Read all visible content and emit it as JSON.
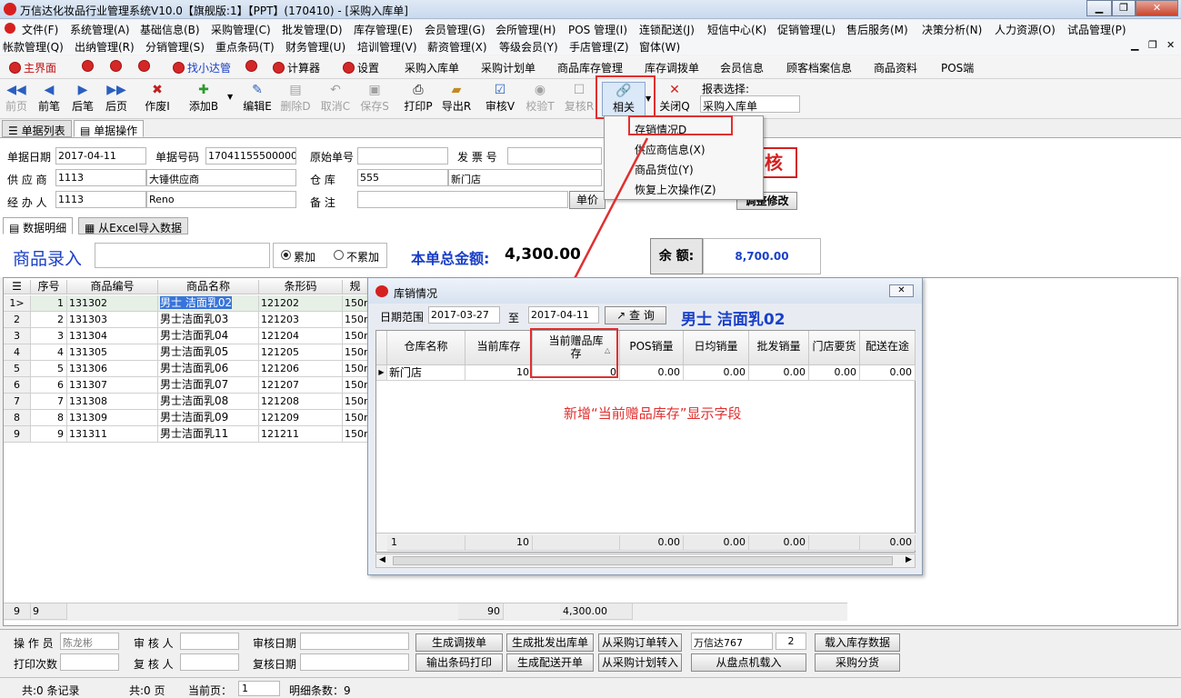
{
  "window": {
    "title": "万信达化妆品行业管理系统V10.0【旗舰版:1】【PPT】(170410) - [采购入库单]",
    "minimize": "▁",
    "restore": "❐",
    "close": "✕",
    "child_minimize": "▁",
    "child_restore": "❐",
    "child_close": "✕"
  },
  "menu_row1": [
    "文件(F)",
    "系统管理(A)",
    "基础信息(B)",
    "采购管理(C)",
    "批发管理(D)",
    "库存管理(E)",
    "会员管理(G)",
    "会所管理(H)",
    "POS 管理(I)",
    "连锁配送(J)",
    "短信中心(K)",
    "促销管理(L)",
    "售后服务(M)",
    "决策分析(N)",
    "人力资源(O)",
    "试品管理(P)"
  ],
  "menu_row2": [
    "帐款管理(Q)",
    "出纳管理(R)",
    "分销管理(S)",
    "重点条码(T)",
    "财务管理(U)",
    "培训管理(V)",
    "薪资管理(X)",
    "等级会员(Y)",
    "手店管理(Z)",
    "窗体(W)"
  ],
  "quickbar": [
    "主界面",
    "",
    "",
    "",
    "找小达管",
    "",
    "计算器",
    "设置",
    "采购入库单",
    "采购计划单",
    "商品库存管理",
    "库存调拨单",
    "会员信息",
    "顾客档案信息",
    "商品资料",
    "POS端"
  ],
  "toolbar": {
    "buttons": [
      "前页",
      "前笔",
      "后笔",
      "后页",
      "作废I",
      "添加B",
      "编辑E",
      "删除D",
      "取消C",
      "保存S",
      "打印P",
      "导出R",
      "审核V",
      "校验T",
      "复核R",
      "相关",
      "关闭Q"
    ],
    "report_label": "报表选择:",
    "report_value": "采购入库单"
  },
  "tabs1": [
    "单据列表",
    "单据操作"
  ],
  "form": {
    "date_label": "单据日期",
    "date_value": "2017-04-11",
    "number_label": "单据号码",
    "number_value": "1704115550000001",
    "orig_label": "原始单号",
    "orig_value": "",
    "invoice_label": "发 票 号",
    "invoice_value": "",
    "supplier_label": "供 应 商",
    "supplier_code": "1113",
    "supplier_name": "大锤供应商",
    "warehouse_label": "仓    库",
    "warehouse_code": "555",
    "warehouse_name": "新门店",
    "handler_label": "经 办 人",
    "handler_code": "1113",
    "handler_name": "Reno",
    "note_label": "备    注",
    "note_value": "",
    "stamp": "审核",
    "price_btn": "单价",
    "modify_btn": "调整修改"
  },
  "tabs2": [
    "数据明细",
    "从Excel导入数据"
  ],
  "entry": {
    "label": "商品录入",
    "radio1": "累加",
    "radio2": "不累加",
    "total_label": "本单总金额:",
    "total_value": "4,300.00",
    "balance_label": "余 额:",
    "balance_value": "8,700.00"
  },
  "grid": {
    "headers": [
      "序号",
      "商品编号",
      "商品名称",
      "条形码",
      "规"
    ],
    "rows": [
      [
        "1",
        "131302",
        "男士 洁面乳02",
        "121202",
        "150m"
      ],
      [
        "2",
        "131303",
        "男士洁面乳03",
        "121203",
        "150m"
      ],
      [
        "3",
        "131304",
        "男士洁面乳04",
        "121204",
        "150m"
      ],
      [
        "4",
        "131305",
        "男士洁面乳05",
        "121205",
        "150m"
      ],
      [
        "5",
        "131306",
        "男士洁面乳06",
        "121206",
        "150m"
      ],
      [
        "6",
        "131307",
        "男士洁面乳07",
        "121207",
        "150m"
      ],
      [
        "7",
        "131308",
        "男士洁面乳08",
        "121208",
        "150m"
      ],
      [
        "8",
        "131309",
        "男士洁面乳09",
        "121209",
        "150m"
      ],
      [
        "9",
        "131311",
        "男士洁面乳11",
        "121211",
        "150m"
      ]
    ],
    "current_marker": "1>",
    "footer": {
      "count1": "9",
      "count2": "9",
      "qty": "90",
      "amount": "4,300.00"
    }
  },
  "popup_menu": [
    "存销情况D",
    "供应商信息(X)",
    "商品货位(Y)",
    "恢复上次操作(Z)"
  ],
  "dialog": {
    "title": "库销情况",
    "close": "✕",
    "range_label": "日期范围",
    "from": "2017-03-27",
    "to_label": "至",
    "to": "2017-04-11",
    "query_btn": "查 询",
    "product": "男士 洁面乳02",
    "headers": [
      "仓库名称",
      "当前库存",
      "当前赠品库存",
      "POS销量",
      "日均销量",
      "批发销量",
      "门店要货",
      "配送在途"
    ],
    "row": [
      "新门店",
      "10",
      "0",
      "0.00",
      "0.00",
      "0.00",
      "0.00",
      "0.00"
    ],
    "footer": [
      "1",
      "10",
      "",
      "0.00",
      "0.00",
      "0.00",
      "",
      "0.00"
    ],
    "annotation": "新增“当前赠品库存”显示字段"
  },
  "bottom": {
    "operator_label": "操 作 员",
    "operator_value": "陈龙彬",
    "auditor_label": "审 核 人",
    "audit_date_label": "审核日期",
    "print_label": "打印次数",
    "recheck_label": "复 核 人",
    "recheck_date_label": "复核日期",
    "buttons_row1": [
      "生成调拨单",
      "生成批发出库单",
      "从采购订单转入"
    ],
    "buttons_row2": [
      "输出条码打印",
      "生成配送开单",
      "从采购计划转入"
    ],
    "company": "万信达767",
    "company_num": "2",
    "load_stock": "载入库存数据",
    "load_pos": "从盘点机载入",
    "purchase_dist": "采购分货"
  },
  "status": {
    "records": "共:0 条记录",
    "pages": "共:0 页",
    "current_label": "当前页：",
    "current_value": "1",
    "detail": "明细条数：9"
  },
  "colors": {
    "accent_red": "#e03030",
    "blue_text": "#1a3fc8"
  }
}
